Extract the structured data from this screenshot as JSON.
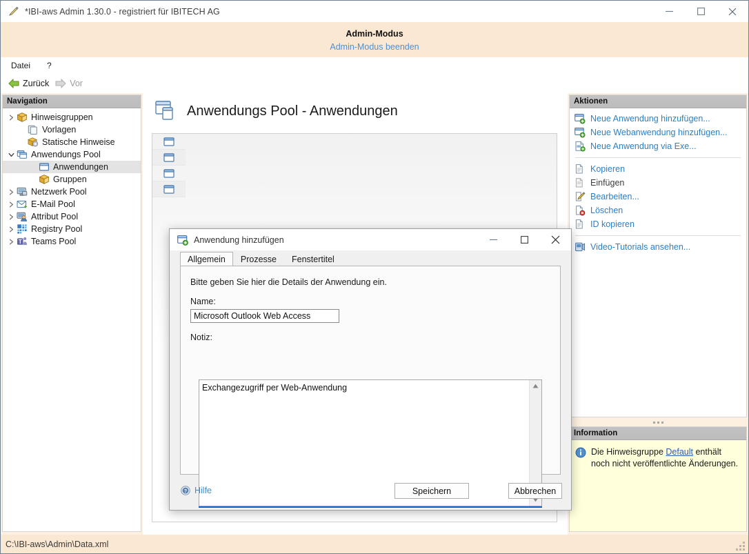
{
  "window": {
    "title": "*IBI-aws Admin 1.30.0 - registriert für IBITECH AG",
    "icon": "app-pen-icon",
    "controls": {
      "minimize": "minimize-icon",
      "maximize": "maximize-icon",
      "close": "close-icon"
    }
  },
  "admin_banner": {
    "title": "Admin-Modus",
    "link": "Admin-Modus beenden"
  },
  "menu": {
    "items": [
      "Datei",
      "?"
    ]
  },
  "navtoolbar": {
    "back": "Zurück",
    "forward": "Vor"
  },
  "navigation": {
    "header": "Navigation",
    "items": [
      {
        "label": "Hinweisgruppen",
        "icon": "box-yellow-icon",
        "chevron": "collapsed",
        "indent": 0,
        "selected": false
      },
      {
        "label": "Vorlagen",
        "icon": "templates-icon",
        "chevron": "none",
        "indent": 1,
        "selected": false
      },
      {
        "label": "Statische Hinweise",
        "icon": "box-gear-icon",
        "chevron": "none",
        "indent": 1,
        "selected": false
      },
      {
        "label": "Anwendungs Pool",
        "icon": "windows-stack-icon",
        "chevron": "expanded",
        "indent": 0,
        "selected": false
      },
      {
        "label": "Anwendungen",
        "icon": "window-icon",
        "chevron": "none",
        "indent": 2,
        "selected": true
      },
      {
        "label": "Gruppen",
        "icon": "box-yellow-icon",
        "chevron": "none",
        "indent": 2,
        "selected": false
      },
      {
        "label": "Netzwerk Pool",
        "icon": "monitor-icon",
        "chevron": "collapsed",
        "indent": 0,
        "selected": false
      },
      {
        "label": "E-Mail Pool",
        "icon": "mail-icon",
        "chevron": "collapsed",
        "indent": 0,
        "selected": false
      },
      {
        "label": "Attribut Pool",
        "icon": "user-monitor-icon",
        "chevron": "collapsed",
        "indent": 0,
        "selected": false
      },
      {
        "label": "Registry Pool",
        "icon": "grid-blue-icon",
        "chevron": "collapsed",
        "indent": 0,
        "selected": false
      },
      {
        "label": "Teams Pool",
        "icon": "teams-icon",
        "chevron": "collapsed",
        "indent": 0,
        "selected": false
      }
    ]
  },
  "content": {
    "title": "Anwendungs Pool - Anwendungen",
    "icon": "applications-icon",
    "list_rows": 4
  },
  "aktionen": {
    "header": "Aktionen",
    "items": [
      {
        "label": "Neue Anwendung hinzufügen...",
        "icon": "window-add-icon",
        "link": true,
        "separator_after": false
      },
      {
        "label": "Neue Webanwendung hinzufügen...",
        "icon": "window-add-icon",
        "link": true,
        "separator_after": false
      },
      {
        "label": "Neue Anwendung via Exe...",
        "icon": "exe-add-icon",
        "link": true,
        "separator_after": true
      },
      {
        "label": "Kopieren",
        "icon": "copy-icon",
        "link": true,
        "separator_after": false
      },
      {
        "label": "Einfügen",
        "icon": "paste-icon",
        "link": false,
        "separator_after": false
      },
      {
        "label": "Bearbeiten...",
        "icon": "edit-pencil-icon",
        "link": true,
        "separator_after": false
      },
      {
        "label": "Löschen",
        "icon": "delete-icon",
        "link": true,
        "separator_after": false
      },
      {
        "label": "ID kopieren",
        "icon": "copy-icon",
        "link": true,
        "separator_after": true
      },
      {
        "label": "Video-Tutorials ansehen...",
        "icon": "video-icon",
        "link": true,
        "separator_after": false
      }
    ]
  },
  "information": {
    "header": "Information",
    "icon": "info-icon",
    "text_before": "Die Hinweisgruppe ",
    "link": "Default",
    "text_after": " enthält noch nicht veröffentlichte Änderungen."
  },
  "statusbar": {
    "path": "C:\\IBI-aws\\Admin\\Data.xml"
  },
  "dialog": {
    "title": "Anwendung hinzufügen",
    "icon": "window-add-icon",
    "controls": {
      "minimize": "minimize-icon",
      "maximize": "maximize-icon",
      "close": "close-icon"
    },
    "tabs": [
      {
        "label": "Allgemein",
        "active": true
      },
      {
        "label": "Prozesse",
        "active": false
      },
      {
        "label": "Fenstertitel",
        "active": false
      }
    ],
    "hint": "Bitte geben Sie hier die Details der Anwendung ein.",
    "name_label": "Name:",
    "name_value": "Microsoft Outlook Web Access",
    "name_placeholder": "",
    "notiz_label": "Notiz:",
    "notiz_value": "Exchangezugriff per Web-Anwendung",
    "notiz_placeholder": "",
    "help_label": "Hilfe",
    "help_icon": "help-circle-icon",
    "save_label": "Speichern",
    "cancel_label": "Abbrechen"
  },
  "colors": {
    "accent_link": "#2a7fc9",
    "banner_bg": "#fbe8d3",
    "info_bg": "#ffffdc",
    "selection": "#e3e3e3",
    "focus_underline": "#1565c0"
  }
}
